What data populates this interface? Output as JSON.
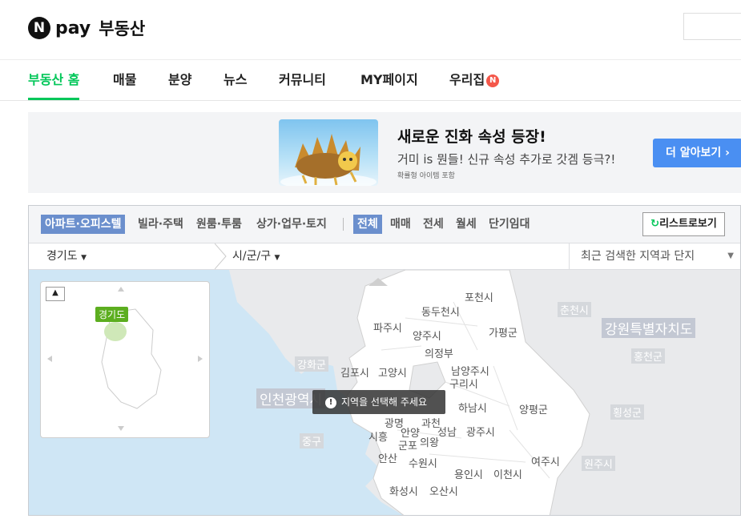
{
  "header": {
    "logo_n": "N",
    "logo_pay": "pay",
    "logo_title": "부동산"
  },
  "nav": {
    "items": [
      "부동산 홈",
      "매물",
      "분양",
      "뉴스",
      "커뮤니티",
      "MY페이지",
      "우리집"
    ],
    "badge": "N"
  },
  "banner": {
    "title": "새로운 진화 속성 등장!",
    "subtitle": "거미 is 뭔들! 신규 속성 추가로 갓겜 등극?!",
    "note": "확률형 아이템 포함",
    "button": "더 알아보기 ›",
    "button_color": "#4a8ff2"
  },
  "property_tabs": [
    "아파트·오피스텔",
    "빌라·주택",
    "원룸·투룸",
    "상가·업무·토지"
  ],
  "deal_tabs": [
    "전체",
    "매매",
    "전세",
    "월세",
    "단기임대"
  ],
  "list_button": "리스트로보기",
  "selectors": {
    "province": "경기도",
    "city": "시/군/구",
    "recent": "최근 검색한 지역과 단지"
  },
  "minimap": {
    "label": "경기도"
  },
  "toast": "지역을 선택해 주세요",
  "map_labels": [
    "포천시",
    "동두천시",
    "파주시",
    "양주시",
    "가평군",
    "의정부",
    "춘천시",
    "강원특별자치도",
    "홍천군",
    "강화군",
    "김포시",
    "고양시",
    "남양주시",
    "구리시",
    "인천광역시",
    "하남시",
    "양평군",
    "횡성군",
    "광명",
    "과천",
    "시흥",
    "안양",
    "성남",
    "광주시",
    "군포",
    "의왕",
    "중구",
    "안산",
    "수원시",
    "용인시",
    "이천시",
    "여주시",
    "원주시",
    "화성시",
    "오산시"
  ],
  "colors": {
    "accent": "#03c75a",
    "tab_selected": "#6b8fcd",
    "sea": "#cfe6f5",
    "land": "#ffffff",
    "outside": "#e9eaec"
  }
}
